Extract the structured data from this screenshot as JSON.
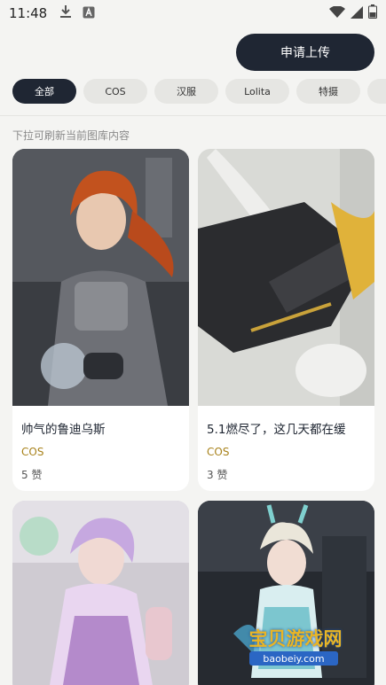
{
  "status_bar": {
    "time": "11:48"
  },
  "header": {
    "upload_label": "申请上传"
  },
  "categories": [
    {
      "label": "全部",
      "active": true
    },
    {
      "label": "COS",
      "active": false
    },
    {
      "label": "汉服",
      "active": false
    },
    {
      "label": "Lolita",
      "active": false
    },
    {
      "label": "特摄",
      "active": false
    }
  ],
  "hint": "下拉可刷新当前图库内容",
  "cards": [
    {
      "title": "帅气的鲁迪乌斯",
      "tag": "COS",
      "likes": "5 赞"
    },
    {
      "title": "5.1燃尽了，这几天都在缓",
      "tag": "COS",
      "likes": "3 赞"
    },
    {
      "title": "",
      "tag": "",
      "likes": ""
    },
    {
      "title": "",
      "tag": "",
      "likes": ""
    }
  ],
  "watermark": {
    "brand": "宝贝游戏网",
    "url": "baobeiy.com"
  },
  "colors": {
    "accent_dark": "#1f2633",
    "tag_gold": "#a8821b",
    "background": "#f4f4f2"
  }
}
